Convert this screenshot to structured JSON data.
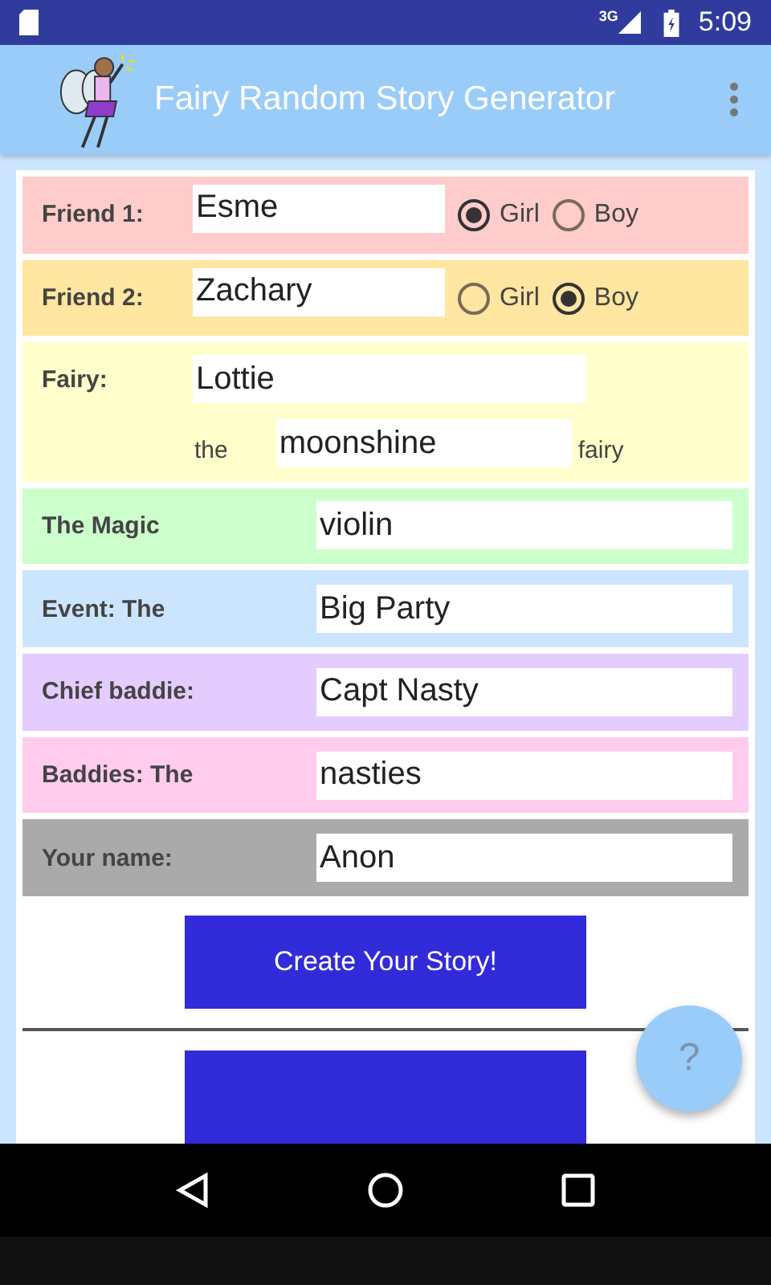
{
  "status_bar": {
    "network": "3G",
    "time": "5:09"
  },
  "app_bar": {
    "title": "Fairy Random Story Generator"
  },
  "rows": [
    {
      "kind": "friend",
      "label": "Friend 1:",
      "value": "Esme",
      "color": "#ffcccc",
      "options": [
        {
          "label": "Girl",
          "selected": true
        },
        {
          "label": "Boy",
          "selected": false
        }
      ]
    },
    {
      "kind": "friend",
      "label": "Friend 2:",
      "value": "Zachary",
      "color": "#ffe6a1",
      "options": [
        {
          "label": "Girl",
          "selected": false
        },
        {
          "label": "Boy",
          "selected": true
        }
      ]
    },
    {
      "kind": "fairy",
      "label": "Fairy:",
      "value": "Lottie",
      "prefix": "the",
      "value_2": "moonshine",
      "suffix": "fairy",
      "color": "#ffffcc"
    },
    {
      "kind": "plain",
      "label": "The Magic",
      "value": "violin",
      "color": "#ccffcc"
    },
    {
      "kind": "plain",
      "label": "Event: The",
      "value": "Big Party",
      "color": "#cce5ff"
    },
    {
      "kind": "plain",
      "label": "Chief baddie:",
      "value": "Capt Nasty",
      "color": "#e5ccff"
    },
    {
      "kind": "plain",
      "label": "Baddies: The",
      "value": "nasties",
      "color": "#ffccee"
    },
    {
      "kind": "plain",
      "label": "Your name:",
      "value": "Anon",
      "color": "#aaaaaa"
    }
  ],
  "create_button": "Create Your Story!",
  "help_button": "?"
}
